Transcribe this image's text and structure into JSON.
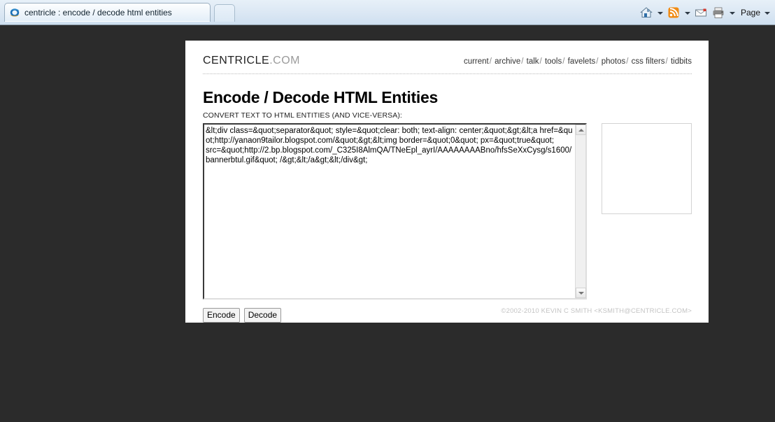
{
  "browser": {
    "tab": {
      "title": "centricle : encode / decode html entities",
      "favicon": "internet-explorer-icon"
    },
    "new_tab_label": "",
    "toolbar": [
      {
        "name": "home-icon",
        "label": ""
      },
      {
        "name": "home-dropdown-caret",
        "label": ""
      },
      {
        "name": "rss-feed-icon",
        "label": ""
      },
      {
        "name": "rss-dropdown-caret",
        "label": ""
      },
      {
        "name": "mail-icon",
        "label": ""
      },
      {
        "name": "print-icon",
        "label": ""
      },
      {
        "name": "print-dropdown-caret",
        "label": ""
      },
      {
        "name": "page-menu",
        "label": "Page"
      },
      {
        "name": "page-dropdown-caret",
        "label": ""
      }
    ],
    "page_menu_label": "Page"
  },
  "site": {
    "logo_main": "CENTRICLE",
    "logo_suffix": ".COM",
    "nav": [
      "current",
      "archive",
      "talk",
      "tools",
      "favelets",
      "photos",
      "css filters",
      "tidbits"
    ],
    "nav_separator": "/"
  },
  "main": {
    "title": "Encode / Decode HTML Entities",
    "subtitle": "CONVERT TEXT TO HTML ENTITIES (AND VICE-VERSA):",
    "textarea": {
      "value": "&lt;div class=&quot;separator&quot; style=&quot;clear: both; text-align: center;&quot;&gt;&lt;a href=&quot;http://yanaon9tailor.blogspot.com/&quot;&gt;&lt;img border=&quot;0&quot; px=&quot;true&quot;\nsrc=&quot;http://2.bp.blogspot.com/_C325I8AlmQA/TNeEpl_ayrI/AAAAAAAABno/hfsSeXxCysg/s1600/bannerbtul.gif&quot; /&gt;&lt;/a&gt;&lt;/div&gt;",
      "placeholder": ""
    },
    "buttons": {
      "encode": "Encode",
      "decode": "Decode"
    },
    "side_box_label": ""
  },
  "footer": {
    "copyright": "©2002-2010 KEVIN C SMITH <KSMITH@CENTRICLE.COM>"
  },
  "colors": {
    "page_background": "#2b2b2b",
    "content_background": "#ffffff",
    "chrome_background": "#dce8f4",
    "footer_text": "#c4c4c4",
    "logo_suffix": "#9b9b9b"
  }
}
